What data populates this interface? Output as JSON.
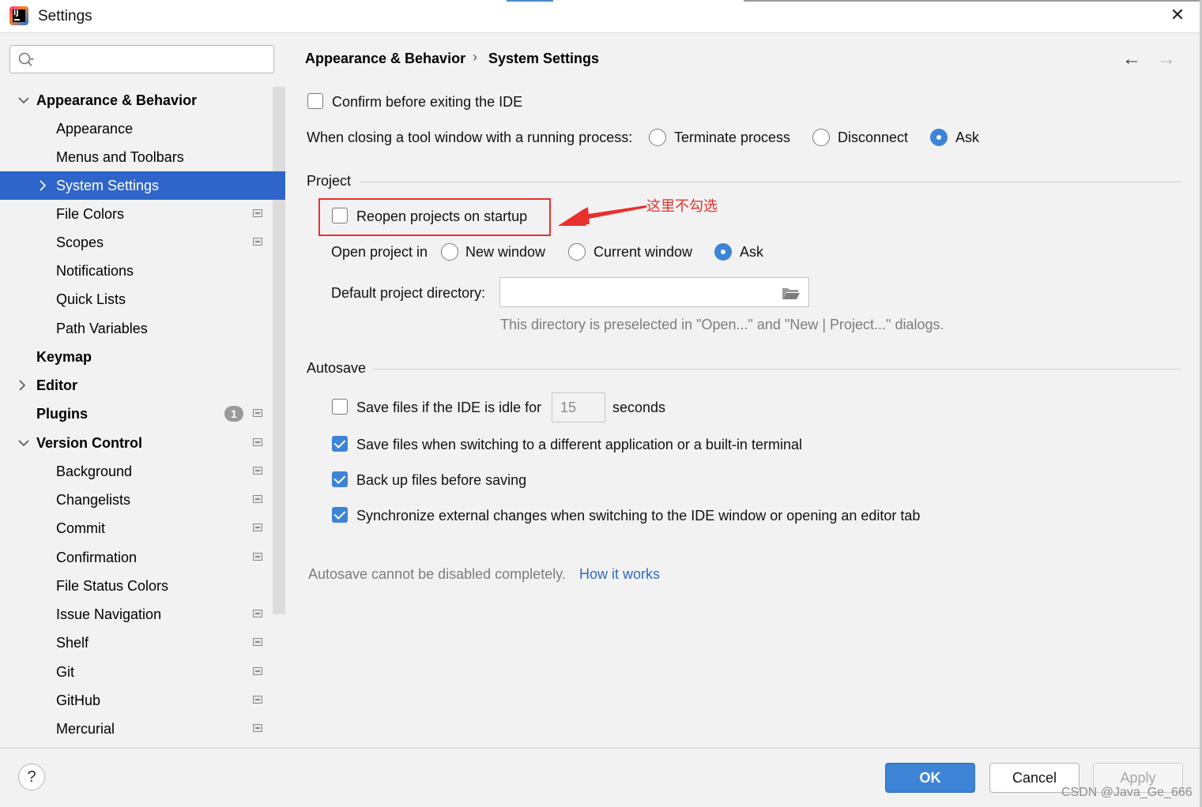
{
  "window": {
    "title": "Settings",
    "close_glyph": "✕"
  },
  "search": {
    "placeholder": ""
  },
  "sidebar": {
    "items": [
      {
        "label": "Appearance & Behavior",
        "bold": true,
        "expanded": true
      },
      {
        "label": "Appearance"
      },
      {
        "label": "Menus and Toolbars"
      },
      {
        "label": "System Settings",
        "selected": true
      },
      {
        "label": "File Colors"
      },
      {
        "label": "Scopes"
      },
      {
        "label": "Notifications"
      },
      {
        "label": "Quick Lists"
      },
      {
        "label": "Path Variables"
      },
      {
        "label": "Keymap",
        "bold": true
      },
      {
        "label": "Editor",
        "bold": true
      },
      {
        "label": "Plugins",
        "bold": true,
        "badge": "1"
      },
      {
        "label": "Version Control",
        "bold": true,
        "expanded": true
      },
      {
        "label": "Background"
      },
      {
        "label": "Changelists"
      },
      {
        "label": "Commit"
      },
      {
        "label": "Confirmation"
      },
      {
        "label": "File Status Colors"
      },
      {
        "label": "Issue Navigation"
      },
      {
        "label": "Shelf"
      },
      {
        "label": "Git"
      },
      {
        "label": "GitHub"
      },
      {
        "label": "Mercurial"
      }
    ]
  },
  "header": {
    "breadcrumb": [
      "Appearance & Behavior",
      "System Settings"
    ],
    "separator": "›",
    "back_glyph": "←",
    "forward_glyph": "→"
  },
  "general": {
    "confirm_exit": {
      "label": "Confirm before exiting the IDE",
      "checked": false
    },
    "closing_label": "When closing a tool window with a running process:",
    "closing_options": [
      "Terminate process",
      "Disconnect",
      "Ask"
    ],
    "closing_selected": "Ask"
  },
  "project": {
    "section_title": "Project",
    "reopen": {
      "label": "Reopen projects on startup",
      "checked": false
    },
    "annotation": "这里不勾选",
    "open_in_label": "Open project in",
    "open_in_options": [
      "New window",
      "Current window",
      "Ask"
    ],
    "open_in_selected": "Ask",
    "default_dir_label": "Default project directory:",
    "default_dir_value": "",
    "default_dir_hint": "This directory is preselected in \"Open...\" and \"New | Project...\" dialogs."
  },
  "autosave": {
    "section_title": "Autosave",
    "idle": {
      "label": "Save files if the IDE is idle for",
      "checked": false,
      "value": "15",
      "unit": "seconds"
    },
    "switching": {
      "label": "Save files when switching to a different application or a built-in terminal",
      "checked": true
    },
    "backup": {
      "label": "Back up files before saving",
      "checked": true
    },
    "sync": {
      "label": "Synchronize external changes when switching to the IDE window or opening an editor tab",
      "checked": true
    },
    "note": "Autosave cannot be disabled completely.",
    "link": "How it works"
  },
  "footer": {
    "help": "?",
    "ok": "OK",
    "cancel": "Cancel",
    "apply": "Apply",
    "watermark": "CSDN @Java_Ge_666"
  },
  "colors": {
    "accent": "#3d84d6",
    "selection": "#2f65ca",
    "annotation": "#e8302e",
    "link": "#2f6bc0"
  }
}
